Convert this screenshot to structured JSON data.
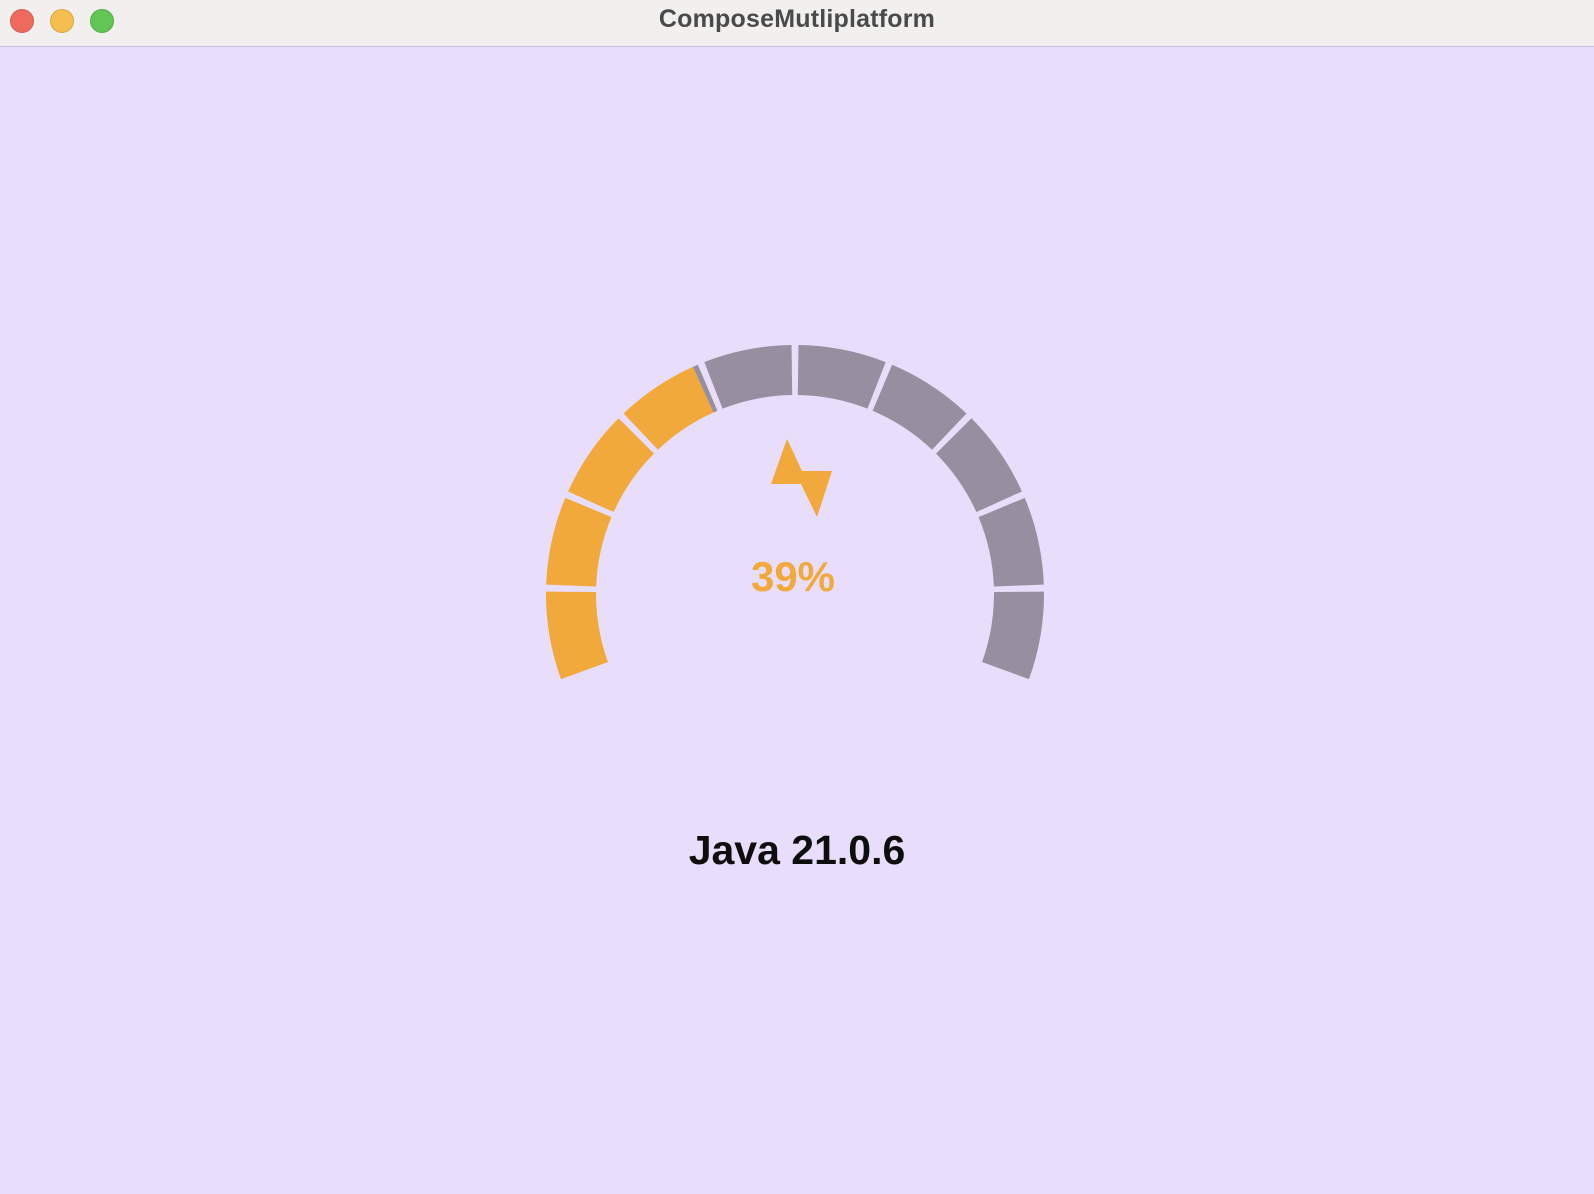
{
  "window": {
    "title": "ComposeMutliplatform",
    "controls": [
      "close",
      "minimize",
      "maximize"
    ]
  },
  "gauge": {
    "segment_count": 10,
    "progress_fraction": 0.39,
    "percent_text": "39%",
    "icon": "lightning-bolt-icon",
    "colors": {
      "active": "#f0a93a",
      "inactive": "#978fa0",
      "background": "#e8ddfb"
    }
  },
  "version": {
    "text": "Java 21.0.6"
  }
}
